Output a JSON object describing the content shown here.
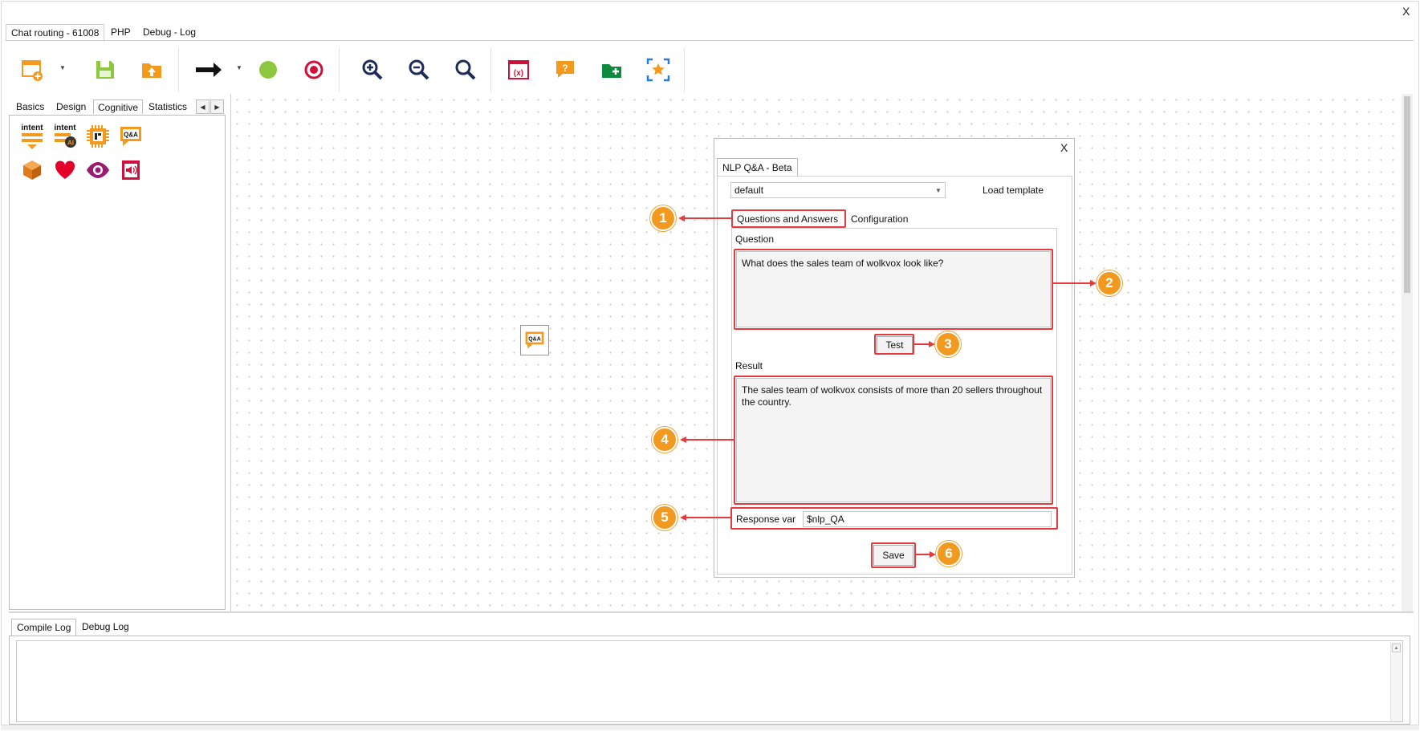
{
  "window": {
    "close_label": "X"
  },
  "top_tabs": [
    {
      "label": "Chat routing - 61008",
      "active": true
    },
    {
      "label": "PHP",
      "active": false
    },
    {
      "label": "Debug - Log",
      "active": false
    }
  ],
  "toolbar": {
    "icons": [
      "new-flow-icon",
      "save-icon",
      "upload-folder-icon",
      "arrow-connector-icon",
      "start-node-icon",
      "end-node-icon",
      "zoom-in-icon",
      "zoom-out-icon",
      "zoom-fit-icon",
      "variables-icon",
      "help-chat-icon",
      "add-folder-icon",
      "center-view-icon"
    ]
  },
  "left_panel": {
    "tabs": [
      {
        "label": "Basics",
        "active": false
      },
      {
        "label": "Design",
        "active": false
      },
      {
        "label": "Cognitive",
        "active": true
      },
      {
        "label": "Statistics",
        "active": false
      }
    ],
    "palette": [
      {
        "icon": "intent-icon",
        "text": "intent"
      },
      {
        "icon": "intent-ai-icon",
        "text": "intent",
        "badge": "AI"
      },
      {
        "icon": "chip-icon"
      },
      {
        "icon": "qa-icon",
        "text": "Q&A"
      },
      {
        "icon": "box-icon"
      },
      {
        "icon": "heart-icon"
      },
      {
        "icon": "eye-icon"
      },
      {
        "icon": "speaker-icon"
      }
    ]
  },
  "canvas": {
    "node_label": "Q&A"
  },
  "dialog": {
    "close_label": "X",
    "tab_label": "NLP Q&A - Beta",
    "template_select": "default",
    "load_template": "Load template",
    "subtabs": [
      {
        "label": "Questions and Answers",
        "active": true
      },
      {
        "label": "Configuration",
        "active": false
      }
    ],
    "question_label": "Question",
    "question_value": "What does the sales team of wolkvox look like?",
    "test_button": "Test",
    "result_label": "Result",
    "result_value": "The sales team of wolkvox consists of more than 20 sellers throughout the country.",
    "response_var_label": "Response var",
    "response_var_value": "$nlp_QA",
    "save_button": "Save"
  },
  "annotations": [
    "1",
    "2",
    "3",
    "4",
    "5",
    "6"
  ],
  "log": {
    "tabs": [
      {
        "label": "Compile Log",
        "active": true
      },
      {
        "label": "Debug Log",
        "active": false
      }
    ]
  },
  "colors": {
    "highlight": "#e53a3e",
    "badge": "#f29a1f",
    "accent_orange": "#f39a1e",
    "accent_green": "#8dc63f",
    "accent_red": "#d0103a"
  }
}
